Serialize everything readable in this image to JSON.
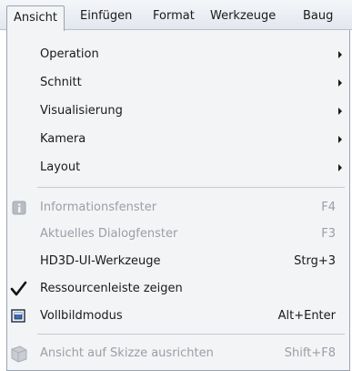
{
  "menubar": {
    "items": [
      {
        "label": "Ansicht"
      },
      {
        "label": "Einfügen"
      },
      {
        "label": "Format"
      },
      {
        "label": "Werkzeuge"
      },
      {
        "label": "Baug"
      }
    ]
  },
  "menu": {
    "submenus": [
      {
        "label": "Operation"
      },
      {
        "label": "Schnitt"
      },
      {
        "label": "Visualisierung"
      },
      {
        "label": "Kamera"
      },
      {
        "label": "Layout"
      }
    ],
    "items": [
      {
        "label": "Informationsfenster",
        "shortcut": "F4",
        "icon": "info-icon",
        "enabled": false
      },
      {
        "label": "Aktuelles Dialogfenster",
        "shortcut": "F3",
        "enabled": false
      },
      {
        "label": "HD3D-UI-Werkzeuge",
        "shortcut": "Strg+3",
        "enabled": true
      },
      {
        "label": "Ressourcenleiste zeigen",
        "shortcut": "",
        "icon": "checkmark-icon",
        "checked": true,
        "enabled": true
      },
      {
        "label": "Vollbildmodus",
        "shortcut": "Alt+Enter",
        "icon": "fullscreen-icon",
        "enabled": true
      },
      {
        "label": "Ansicht auf Skizze ausrichten",
        "shortcut": "Shift+F8",
        "icon": "align-to-sketch-icon",
        "enabled": false
      }
    ]
  },
  "colors": {
    "menu_bg": "#f3f4f6",
    "disabled_text": "#9a9ea6",
    "border": "#9aa3b0"
  }
}
